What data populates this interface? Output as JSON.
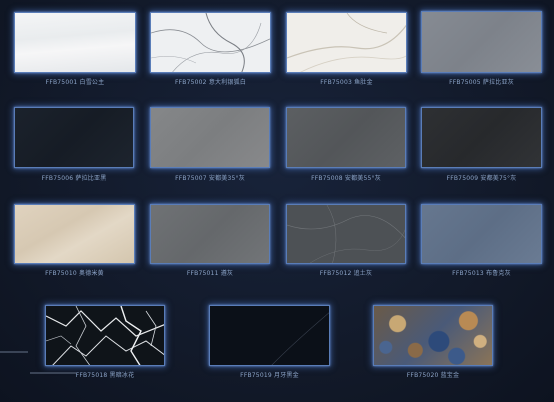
{
  "tiles": [
    {
      "code": "FFB75001",
      "name": "白雪公主"
    },
    {
      "code": "FFB75002",
      "name": "意大利银狐白"
    },
    {
      "code": "FFB75003",
      "name": "鱼肚金"
    },
    {
      "code": "FFB75005",
      "name": "萨拉比亚灰"
    },
    {
      "code": "FFB75006",
      "name": "萨拉比亚黑"
    },
    {
      "code": "FFB75007",
      "name": "安都美35°灰"
    },
    {
      "code": "FFB75008",
      "name": "安都美55°灰"
    },
    {
      "code": "FFB75009",
      "name": "安都美75°灰"
    },
    {
      "code": "FFB75010",
      "name": "奥德米黄"
    },
    {
      "code": "FFB75011",
      "name": "遵灰"
    },
    {
      "code": "FFB75012",
      "name": "追土灰"
    },
    {
      "code": "FFB75013",
      "name": "布鲁克灰"
    },
    {
      "code": "FFB75018",
      "name": "黑暗冰花"
    },
    {
      "code": "FFB75019",
      "name": "月牙黑金"
    },
    {
      "code": "FFB75020",
      "name": "蓝宝金"
    }
  ]
}
